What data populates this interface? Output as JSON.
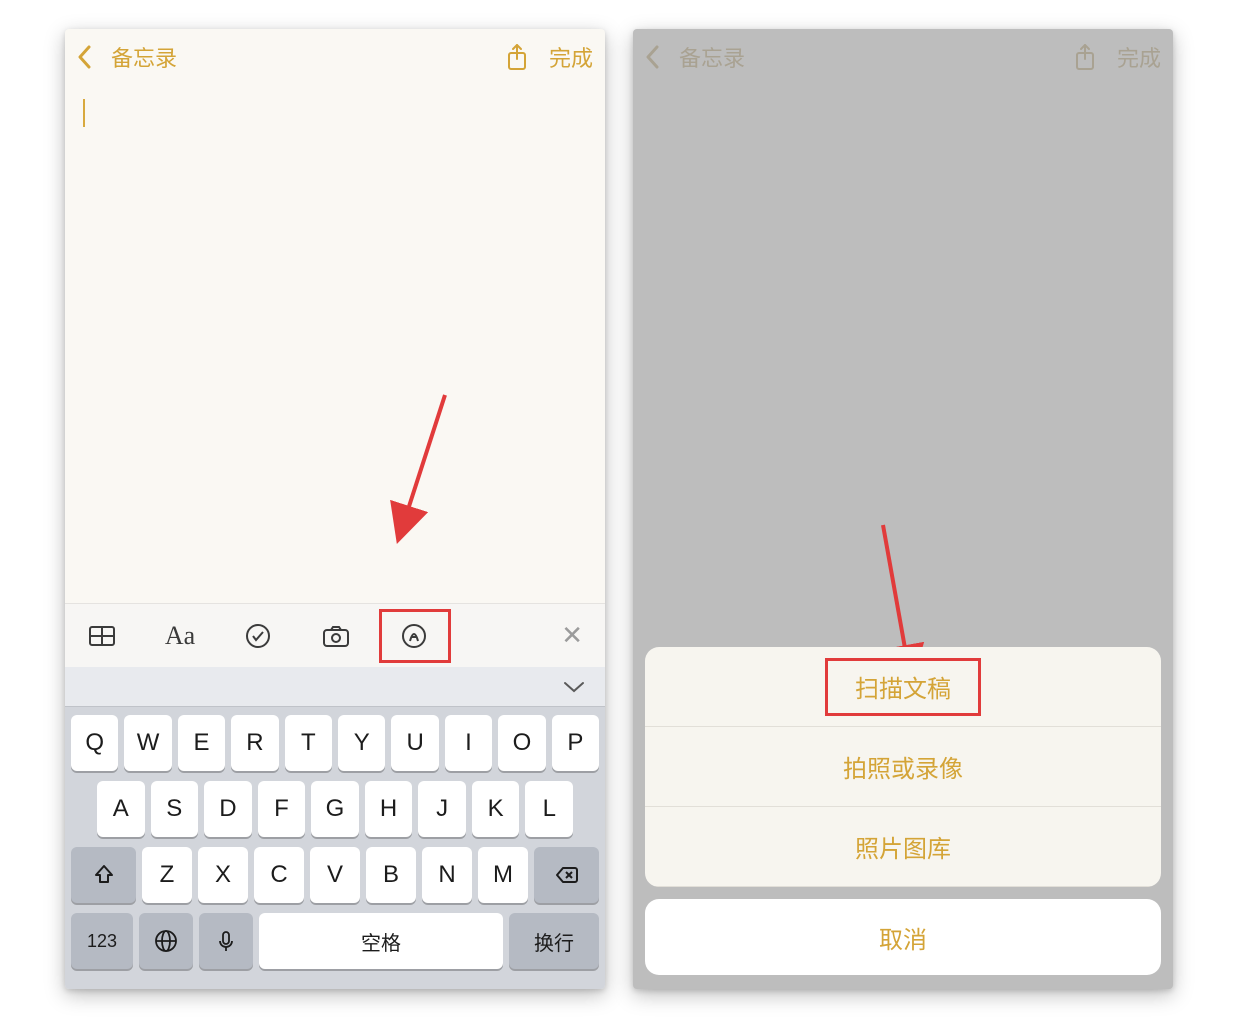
{
  "left": {
    "nav": {
      "back_label": "备忘录",
      "done_label": "完成"
    },
    "keyboard": {
      "row1": [
        "Q",
        "W",
        "E",
        "R",
        "T",
        "Y",
        "U",
        "I",
        "O",
        "P"
      ],
      "row2": [
        "A",
        "S",
        "D",
        "F",
        "G",
        "H",
        "J",
        "K",
        "L"
      ],
      "row3": [
        "Z",
        "X",
        "C",
        "V",
        "B",
        "N",
        "M"
      ],
      "num_key": "123",
      "space_key": "空格",
      "return_key": "换行"
    }
  },
  "right": {
    "nav": {
      "back_label": "备忘录",
      "done_label": "完成"
    },
    "sheet": {
      "scan": "扫描文稿",
      "photo": "拍照或录像",
      "library": "照片图库",
      "cancel": "取消"
    }
  }
}
